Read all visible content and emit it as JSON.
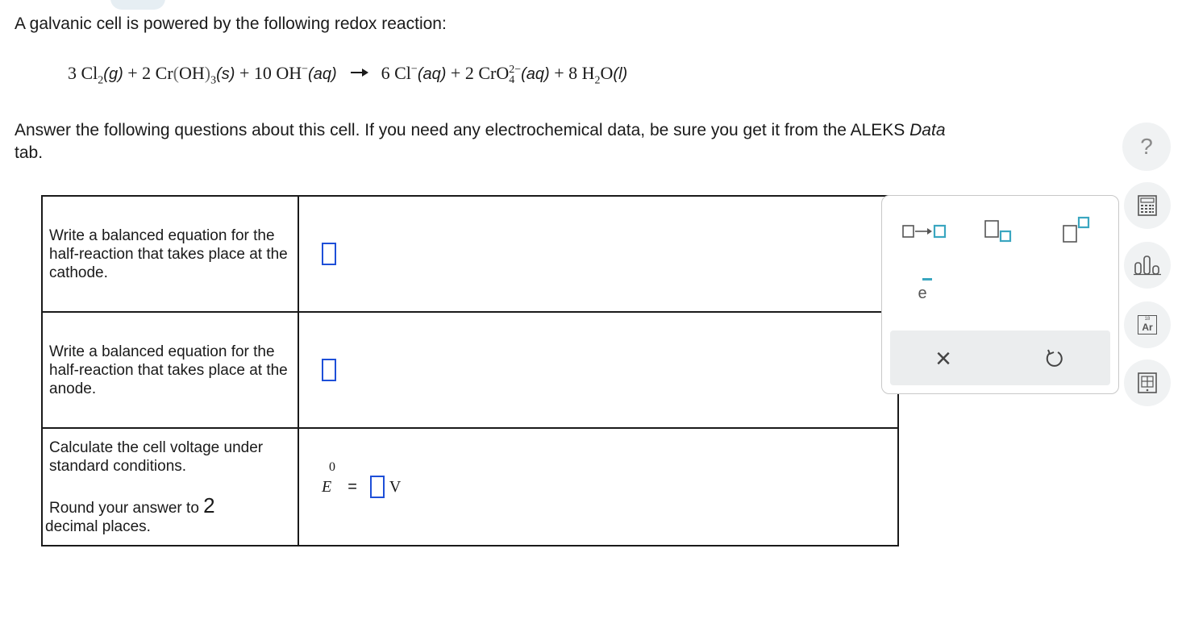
{
  "intro": "A galvanic cell is powered by the following redox reaction:",
  "reaction": {
    "r1_coef": "3",
    "r1_species": "Cl",
    "r1_sub": "2",
    "r1_state": "(g)",
    "plus": "+",
    "r2_coef": "2",
    "r2_species": "Cr",
    "r2_group": "OH",
    "r2_sub": "3",
    "r2_state": "(s)",
    "r3_coef": "10",
    "r3_species": "OH",
    "r3_charge": "−",
    "r3_state": "(aq)",
    "p1_coef": "6",
    "p1_species": "Cl",
    "p1_charge": "−",
    "p1_state": "(aq)",
    "p2_coef": "2",
    "p2_species": "CrO",
    "p2_sub": "4",
    "p2_charge": "2−",
    "p2_state": "(aq)",
    "p3_coef": "8",
    "p3_species_h": "H",
    "p3_sub": "2",
    "p3_species_o": "O",
    "p3_state": "(l)"
  },
  "instructions": {
    "text": "Answer the following questions about this cell. If you need any electrochemical data, be sure you get it from the ALEKS ",
    "italic": "Data",
    "end": " tab."
  },
  "help_glyph": "?",
  "questions": [
    {
      "text": "Write a balanced equation for the half-reaction that takes place at the cathode."
    },
    {
      "text": "Write a balanced equation for the half-reaction that takes place at the anode."
    },
    {
      "text": "Calculate the cell voltage under standard conditions.",
      "round_prefix": "Round your answer to ",
      "round_digits": "2",
      "round_suffix": " decimal places."
    }
  ],
  "voltage": {
    "symbol": "E",
    "superscript": "0",
    "equals": "=",
    "unit": "V"
  },
  "palette": {
    "electron_label": "e",
    "tools": [
      "reaction-arrow-tool",
      "subscript-tool",
      "superscript-tool",
      "electron-tool"
    ],
    "clear_glyph": "×",
    "undo_glyph": "↺"
  },
  "side_tools": [
    "calculator-icon",
    "chart-icon",
    "periodic-table-icon",
    "data-book-icon"
  ],
  "periodic_element": {
    "number": "18",
    "symbol": "Ar"
  },
  "colors": {
    "accent": "#1e4fd8",
    "teal": "#3aa6c0"
  }
}
